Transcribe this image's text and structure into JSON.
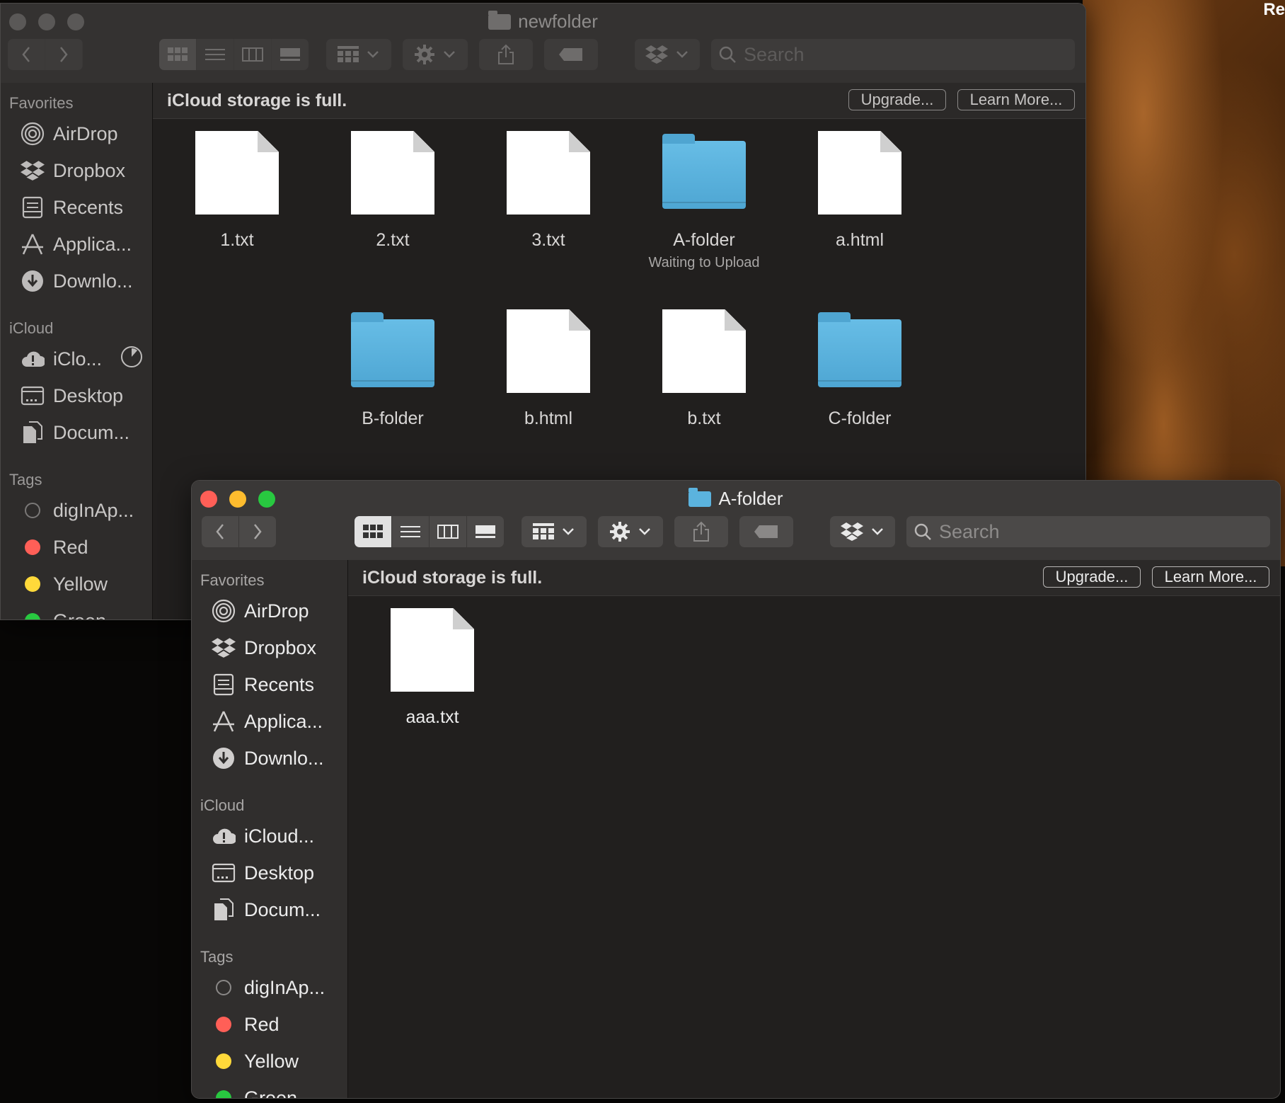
{
  "desktop": {
    "corner_text": "Re"
  },
  "back_window": {
    "title": "newfolder",
    "search_placeholder": "Search",
    "banner": {
      "text": "iCloud storage is full.",
      "upgrade": "Upgrade...",
      "learn_more": "Learn More..."
    },
    "sidebar": {
      "favorites_header": "Favorites",
      "favorites": [
        "AirDrop",
        "Dropbox",
        "Recents",
        "Applica...",
        "Downlo..."
      ],
      "icloud_header": "iCloud",
      "icloud": [
        "iClo...",
        "Desktop",
        "Docum..."
      ],
      "tags_header": "Tags",
      "tags": [
        {
          "label": "digInAp...",
          "color": "none"
        },
        {
          "label": "Red",
          "color": "#ff5f57"
        },
        {
          "label": "Yellow",
          "color": "#ffd93a"
        },
        {
          "label": "Green",
          "color": "#28c840"
        }
      ]
    },
    "files": [
      {
        "name": "1.txt",
        "kind": "document"
      },
      {
        "name": "2.txt",
        "kind": "document"
      },
      {
        "name": "3.txt",
        "kind": "document"
      },
      {
        "name": "A-folder",
        "kind": "folder",
        "status": "Waiting to Upload"
      },
      {
        "name": "a.html",
        "kind": "document"
      },
      {
        "name": "B-folder",
        "kind": "folder"
      },
      {
        "name": "b.html",
        "kind": "document"
      },
      {
        "name": "b.txt",
        "kind": "document"
      },
      {
        "name": "C-folder",
        "kind": "folder"
      }
    ]
  },
  "front_window": {
    "title": "A-folder",
    "search_placeholder": "Search",
    "banner": {
      "text": "iCloud storage is full.",
      "upgrade": "Upgrade...",
      "learn_more": "Learn More..."
    },
    "sidebar": {
      "favorites_header": "Favorites",
      "favorites": [
        "AirDrop",
        "Dropbox",
        "Recents",
        "Applica...",
        "Downlo..."
      ],
      "icloud_header": "iCloud",
      "icloud": [
        "iCloud...",
        "Desktop",
        "Docum..."
      ],
      "tags_header": "Tags",
      "tags": [
        {
          "label": "digInAp...",
          "color": "none"
        },
        {
          "label": "Red",
          "color": "#ff5f57"
        },
        {
          "label": "Yellow",
          "color": "#ffd93a"
        },
        {
          "label": "Green",
          "color": "#28c840"
        }
      ]
    },
    "files": [
      {
        "name": "aaa.txt",
        "kind": "document"
      }
    ]
  },
  "colors": {
    "folder_blue": "#5bb3de",
    "close": "#ff5f57",
    "minimize": "#febc2e",
    "zoom": "#28c840"
  }
}
